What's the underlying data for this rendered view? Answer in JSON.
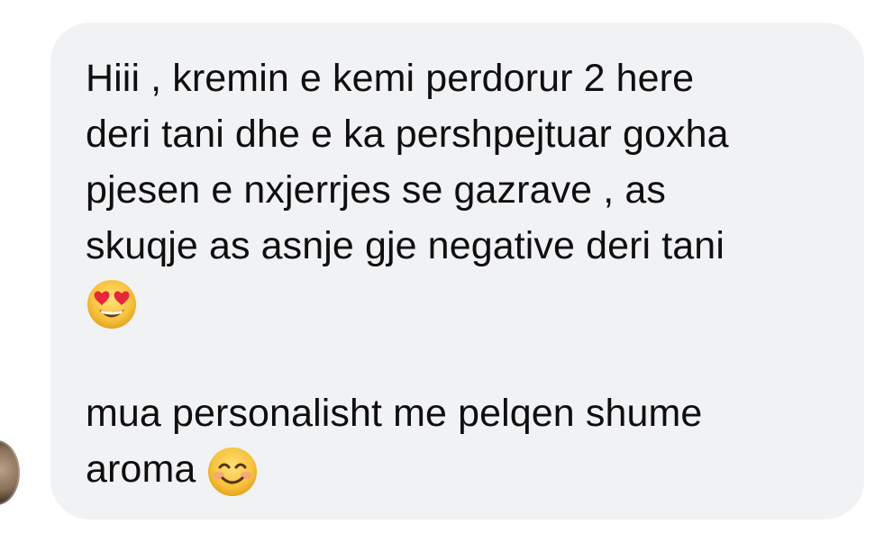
{
  "message": {
    "paragraph1": {
      "line1": "Hiii , kremin e kemi perdorur 2 here",
      "line2": "deri tani dhe e ka pershpejtuar goxha",
      "line3": "pjesen e nxjerrjes se gazrave , as",
      "line4": "skuqje as asnje gje negative deri tani",
      "emoji": "heart-eyes-emoji"
    },
    "paragraph2": {
      "line1": "mua personalisht me pelqen shume",
      "line2": "aroma",
      "emoji": "smiling-emoji"
    }
  },
  "colors": {
    "bubble": "#f1f2f4",
    "text": "#0f0f10",
    "emoji_face": "#f6c23b",
    "heart": "#e8263c"
  }
}
